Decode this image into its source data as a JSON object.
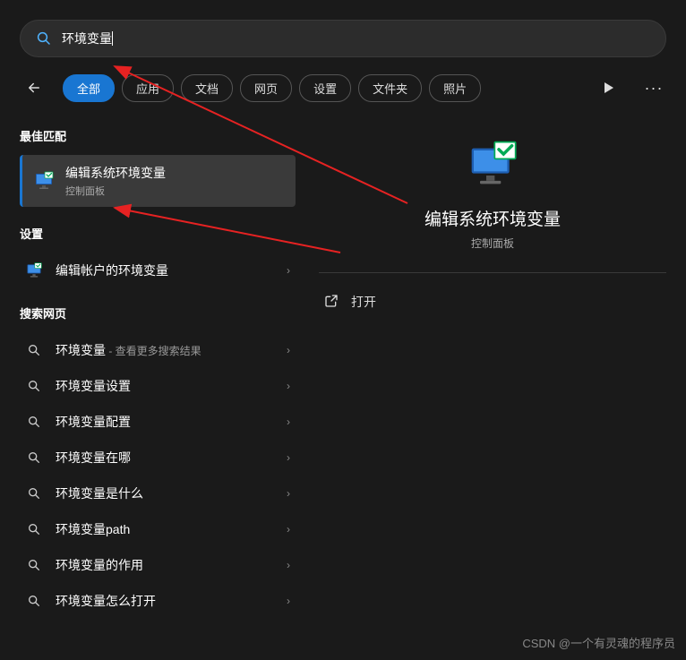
{
  "search": {
    "query": "环境变量"
  },
  "tabs": {
    "all": "全部",
    "apps": "应用",
    "docs": "文档",
    "web": "网页",
    "settings": "设置",
    "folders": "文件夹",
    "photos": "照片"
  },
  "sections": {
    "best_match": "最佳匹配",
    "settings": "设置",
    "web": "搜索网页"
  },
  "best_match": {
    "title": "编辑系统环境变量",
    "subtitle": "控制面板"
  },
  "settings_items": [
    {
      "label": "编辑帐户的环境变量"
    }
  ],
  "web_items": [
    {
      "label": "环境变量",
      "sub": " - 查看更多搜索结果"
    },
    {
      "label": "环境变量设置",
      "sub": ""
    },
    {
      "label": "环境变量配置",
      "sub": ""
    },
    {
      "label": "环境变量在哪",
      "sub": ""
    },
    {
      "label": "环境变量是什么",
      "sub": ""
    },
    {
      "label": "环境变量path",
      "sub": ""
    },
    {
      "label": "环境变量的作用",
      "sub": ""
    },
    {
      "label": "环境变量怎么打开",
      "sub": ""
    }
  ],
  "detail": {
    "title": "编辑系统环境变量",
    "subtitle": "控制面板",
    "open": "打开"
  },
  "watermark": "CSDN @一个有灵魂的程序员"
}
